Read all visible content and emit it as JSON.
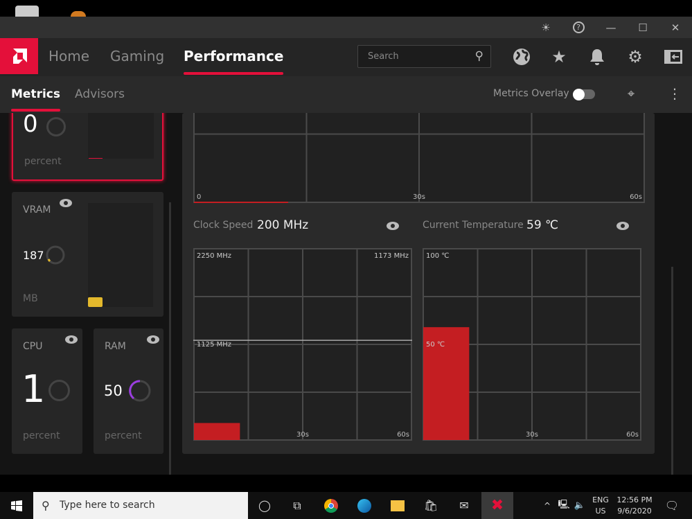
{
  "window": {
    "controls": [
      {
        "name": "bug-report-icon",
        "glyph": "☀"
      },
      {
        "name": "help-icon",
        "glyph": "?"
      },
      {
        "name": "minimize-icon",
        "glyph": "—"
      },
      {
        "name": "maximize-icon",
        "glyph": "☐"
      },
      {
        "name": "close-icon",
        "glyph": "✕"
      }
    ]
  },
  "nav": {
    "tabs": [
      "Home",
      "Gaming",
      "Performance"
    ],
    "active": "Performance",
    "search_placeholder": "Search",
    "icons": [
      {
        "name": "globe-icon",
        "glyph": "🌐"
      },
      {
        "name": "star-icon",
        "glyph": "★"
      },
      {
        "name": "bell-icon",
        "glyph": "🔔"
      },
      {
        "name": "gear-icon",
        "glyph": "⚙"
      },
      {
        "name": "sidebar-toggle-icon",
        "glyph": "⇤"
      }
    ]
  },
  "subnav": {
    "tabs": [
      "Metrics",
      "Advisors"
    ],
    "active": "Metrics",
    "overlay_label": "Metrics Overlay",
    "overlay_on": false
  },
  "cards": {
    "gpu": {
      "value": "0",
      "unit": "percent"
    },
    "vram": {
      "label": "VRAM",
      "value": "187",
      "unit": "MB"
    },
    "cpu": {
      "label": "CPU",
      "value": "1",
      "unit": "percent"
    },
    "ram": {
      "label": "RAM",
      "value": "50",
      "unit": "percent"
    }
  },
  "colors": {
    "accent": "#e4103a",
    "vram": "#e3b82c",
    "ram": "#9b3de0",
    "bar": "#c41e22"
  },
  "chart_data": [
    {
      "type": "bar",
      "x_ticks": [
        "0",
        "30s",
        "60s"
      ],
      "xlim": [
        0,
        60
      ],
      "grid": true
    },
    {
      "type": "bar",
      "title": "Clock Speed",
      "current": "200 MHz",
      "x_ticks": [
        "0",
        "30s",
        "60s"
      ],
      "y_labels": [
        "2250 MHz",
        "1125 MHz"
      ],
      "avg_label": "1173 MHz",
      "avg": 1173,
      "ylim": [
        0,
        2250
      ],
      "values": [
        200
      ],
      "grid": true
    },
    {
      "type": "bar",
      "title": "Current Temperature",
      "current": "59 ℃",
      "x_ticks": [
        "0",
        "30s",
        "60s"
      ],
      "y_labels": [
        "100 ℃",
        "50 ℃"
      ],
      "ylim": [
        0,
        100
      ],
      "values": [
        59
      ],
      "grid": true
    }
  ],
  "taskbar": {
    "search_placeholder": "Type here to search",
    "lang": "ENG",
    "region": "US",
    "time": "12:56 PM",
    "date": "9/6/2020"
  }
}
